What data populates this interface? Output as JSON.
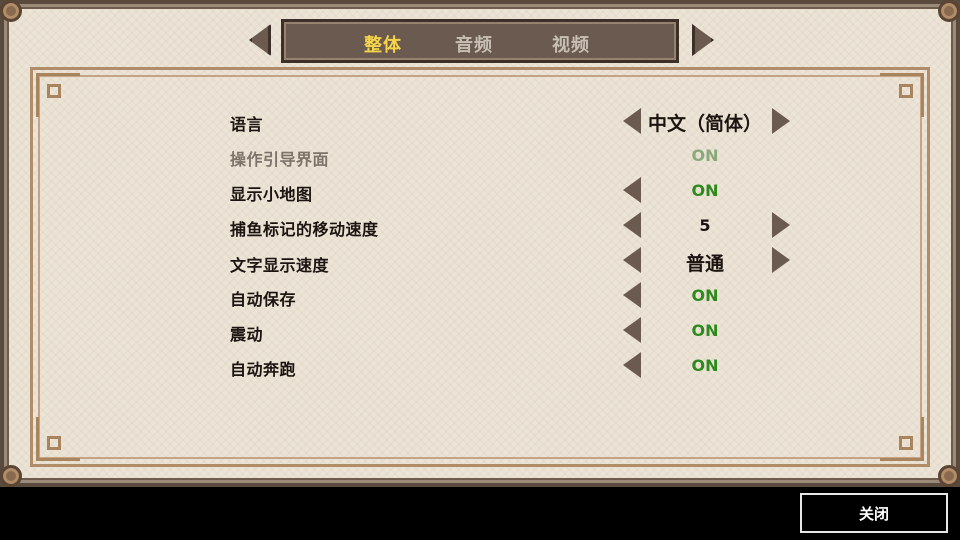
{
  "tabs": [
    {
      "label": "整体",
      "active": true
    },
    {
      "label": "音频",
      "active": false
    },
    {
      "label": "视频",
      "active": false
    }
  ],
  "settings": [
    {
      "label": "语言",
      "value": "中文（简体）",
      "disabled": false
    },
    {
      "label": "操作引导界面",
      "value": "ON",
      "disabled": true
    },
    {
      "label": "显示小地图",
      "value": "ON",
      "disabled": false
    },
    {
      "label": "捕鱼标记的移动速度",
      "value": "5",
      "disabled": false
    },
    {
      "label": "文字显示速度",
      "value": "普通",
      "disabled": false
    },
    {
      "label": "自动保存",
      "value": "ON",
      "disabled": false
    },
    {
      "label": "震动",
      "value": "ON",
      "disabled": false
    },
    {
      "label": "自动奔跑",
      "value": "ON",
      "disabled": false
    }
  ],
  "close_label": "关闭",
  "colors": {
    "active_tab": "#f5d44a",
    "on_value": "#2f8a1e",
    "panel_bg": "#ece4d6",
    "ornament": "#a8845f"
  }
}
